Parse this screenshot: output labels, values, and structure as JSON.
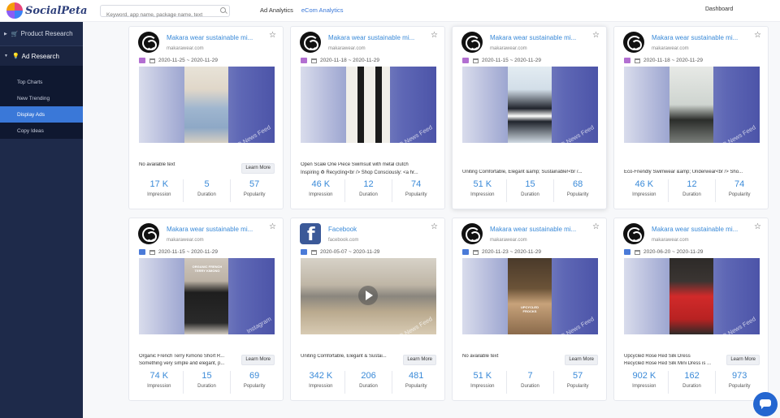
{
  "brand": {
    "name": "SocialPeta"
  },
  "search": {
    "placeholder": "Keyword, app name, package name, text"
  },
  "topnav": {
    "ad_analytics": "Ad Analytics",
    "ecom_analytics": "eCom Analytics",
    "dashboard": "Dashboard"
  },
  "sidebar": {
    "product_research": "Product Research",
    "ad_research": "Ad Research",
    "items": [
      {
        "label": "Top Charts"
      },
      {
        "label": "New Trending"
      },
      {
        "label": "Display Ads",
        "active": true
      },
      {
        "label": "Copy Ideas"
      }
    ]
  },
  "metric_labels": {
    "impression": "Impression",
    "duration": "Duration",
    "popularity": "Popularity"
  },
  "cards": [
    {
      "title": "Makara wear sustainable mi...",
      "domain": "makarawear.com",
      "date": "2020-11-25 ~ 2020-11-29",
      "text1": "No available text",
      "text2": "",
      "learn": "Learn More",
      "watermark": "FB News Feed",
      "impression": "17 K",
      "duration": "5",
      "popularity": "57"
    },
    {
      "title": "Makara wear sustainable mi...",
      "domain": "makarawear.com",
      "date": "2020-11-18 ~ 2020-11-29",
      "text1": "Open Scale One Piece Swimsuit with metal clutch",
      "text2": "Inspiring ♻ Recycling<br /> Shop Consciously: <a hr...",
      "learn": "",
      "watermark": "FB News Feed",
      "impression": "46 K",
      "duration": "12",
      "popularity": "74"
    },
    {
      "title": "Makara wear sustainable mi...",
      "domain": "makarawear.com",
      "date": "2020-11-15 ~ 2020-11-29",
      "text1": "",
      "text2": "Uniting Comfortable, Elegant &amp; Sustainable!<br /...",
      "learn": "",
      "watermark": "FB News Feed",
      "impression": "51 K",
      "duration": "15",
      "popularity": "68"
    },
    {
      "title": "Makara wear sustainable mi...",
      "domain": "makarawear.com",
      "date": "2020-11-18 ~ 2020-11-29",
      "text1": "",
      "text2": "Eco-Friendly Swimwear &amp; Underwear<br /> Sho...",
      "learn": "",
      "watermark": "FB News Feed",
      "impression": "46 K",
      "duration": "12",
      "popularity": "74"
    },
    {
      "title": "Makara wear sustainable mi...",
      "domain": "makarawear.com",
      "date": "2020-11-15 ~ 2020-11-29",
      "text1": "Organic French Terry Kimono Short R...",
      "text2": "Something very simple and elegant, p...",
      "learn": "Learn More",
      "watermark": "Instagram",
      "photo_text": "ORGANIC FRENCH TERRY KIMONO",
      "impression": "74 K",
      "duration": "15",
      "popularity": "69"
    },
    {
      "title": "Facebook",
      "domain": "facebook.com",
      "date": "2020-05-07 ~ 2020-11-29",
      "text1": "Uniting Comfortable, Elegant & Sustai...",
      "text2": "",
      "learn": "Learn More",
      "watermark": "FB News Feed",
      "impression": "342 K",
      "duration": "206",
      "popularity": "481"
    },
    {
      "title": "Makara wear sustainable mi...",
      "domain": "makarawear.com",
      "date": "2020-11-23 ~ 2020-11-29",
      "text1": "No available text",
      "text2": "",
      "learn": "Learn More",
      "watermark": "FB News Feed",
      "photo_text": "UPCYCLED FROCKS",
      "impression": "51 K",
      "duration": "7",
      "popularity": "57"
    },
    {
      "title": "Makara wear sustainable mi...",
      "domain": "makarawear.com",
      "date": "2020-06-20 ~ 2020-11-29",
      "text1": "Upcycled Rose Red Silk Dress",
      "text2": "Recycled Rose Red Silk Mini Dress is ...",
      "learn": "Learn More",
      "watermark": "FB News Feed",
      "impression": "902 K",
      "duration": "162",
      "popularity": "973"
    }
  ]
}
